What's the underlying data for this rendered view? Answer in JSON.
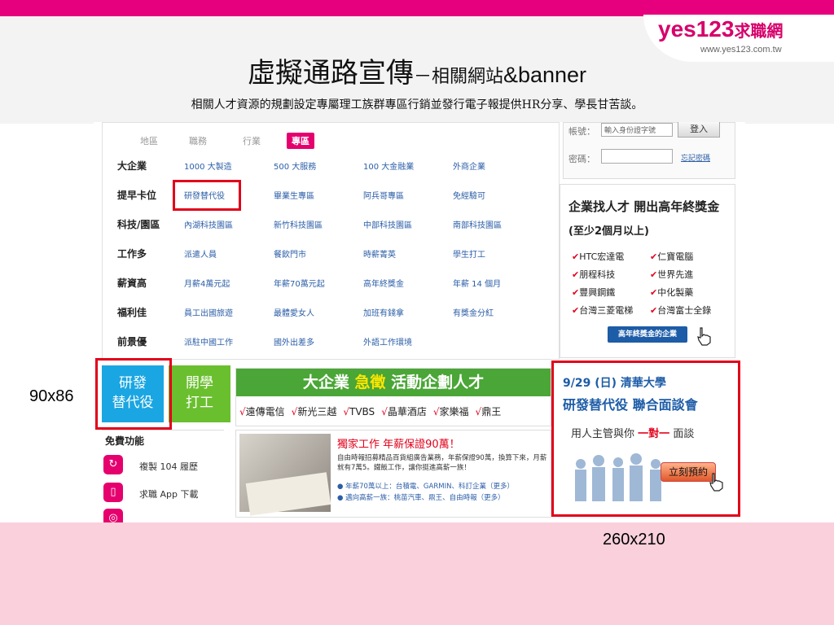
{
  "slide": {
    "title_main": "虛擬通路宣傳",
    "title_dash": "－相關網站",
    "title_tail": "&banner",
    "subtitle": "相關人才資源的規劃設定專屬理工族群專區行銷並發行電子報提供HR分享、學長甘苦談。"
  },
  "logo": {
    "main": "yes123",
    "sub": "求職網",
    "url": "www.yes123.com.tw"
  },
  "site": {
    "tabs": [
      "地區",
      "職務",
      "行業",
      "專區"
    ],
    "active_tab_index": 3,
    "rows": [
      {
        "label": "大企業",
        "cells": [
          "1000 大製造",
          "500 大服務",
          "100 大金融業",
          "外商企業"
        ]
      },
      {
        "label": "提早卡位",
        "cells": [
          "研發替代役",
          "畢業生專區",
          "阿兵哥專區",
          "免經驗可"
        ]
      },
      {
        "label": "科技/園區",
        "cells": [
          "內湖科技園區",
          "新竹科技園區",
          "中部科技園區",
          "南部科技園區"
        ]
      },
      {
        "label": "工作多",
        "cells": [
          "派遣人員",
          "餐飲門市",
          "時薪菁英",
          "學生打工"
        ]
      },
      {
        "label": "薪資高",
        "cells": [
          "月薪4萬元起",
          "年薪70萬元起",
          "高年終獎金",
          "年薪 14 個月"
        ]
      },
      {
        "label": "福利佳",
        "cells": [
          "員工出國旅遊",
          "最體愛女人",
          "加班有錢拿",
          "有獎金分紅"
        ]
      },
      {
        "label": "前景優",
        "cells": [
          "派駐中國工作",
          "國外出差多",
          "外語工作環境",
          ""
        ]
      }
    ],
    "login": {
      "account_label": "帳號：",
      "account_placeholder": "輸入身份證字號",
      "login_button": "登入",
      "password_label": "密碼：",
      "forgot_link": "忘記密碼"
    },
    "promo": {
      "heading": "企業找人才 開出高年終獎金",
      "subheading": "(至少2個月以上)",
      "companies": [
        "HTC宏達電",
        "仁寶電腦",
        "朋程科技",
        "世界先進",
        "豐興鋼鐵",
        "中化製藥",
        "台灣三菱電梯",
        "台灣富士全錄"
      ],
      "button": "高年終獎金的企業"
    },
    "tiles": {
      "rd": "研發 替代役",
      "student": "開學 打工"
    },
    "banner": {
      "lead": "大企業",
      "accent": "急徵",
      "tail": "活動企劃人才",
      "brands": [
        "遠傳電信",
        "新光三越",
        "TVBS",
        "晶華酒店",
        "家樂福",
        "鼎王"
      ]
    },
    "free": {
      "title": "免費功能",
      "items": [
        {
          "label": "複製 104 履歷",
          "icon": "refresh-icon"
        },
        {
          "label": "求職 App 下載",
          "icon": "phone-icon"
        }
      ]
    },
    "news": {
      "headline": "獨家工作 年薪保證90萬！",
      "body": "自由時報招募精品百貨組廣告業務，年薪保證90萬，換算下來，月薪就有7萬5。鐵飯工作，讓你挺進高薪一族！",
      "bullets": [
        "● 年薪70萬以上：台積電、GARMIN、科訂企業（更多）",
        "● 邁向高薪一族：桃苗汽車、鼎王、自由時報（更多）"
      ]
    },
    "campus": {
      "date_line": "9/29 (日) 清華大學",
      "event_line": "研發替代役 聯合面談會",
      "pre": "用人主管與你",
      "hot": "一對一",
      "post": "面談",
      "button": "立刻預約"
    }
  },
  "annotations": {
    "tile_size": "90x86",
    "banner_size": "260x210"
  },
  "colors": {
    "brand_pink": "#e6007e",
    "highlight_red": "#e2001a",
    "link_blue": "#2b5ea7",
    "tile_blue": "#1aa6e2",
    "tile_green": "#6abf2e",
    "banner_green": "#4aa636"
  }
}
